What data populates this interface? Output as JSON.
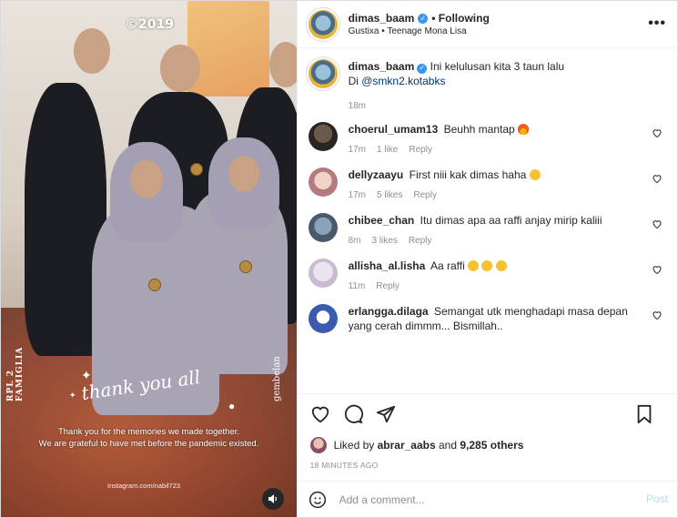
{
  "media": {
    "year_text": "©2019",
    "side_left": "RPL 2 FAMIGLIA",
    "side_right": "gembelan",
    "script_text": "thank you all",
    "message_line1": "Thank you for the memories we made together.",
    "message_line2": "We are grateful to have met before the pandemic existed.",
    "ig_handle": "Instagram.com/nabil723",
    "mute_icon": "speaker-icon"
  },
  "header": {
    "username": "dimas_baam",
    "following_label": "• Following",
    "audio": "Gustixa • Teenage Mona Lisa",
    "more_icon": "more-icon"
  },
  "caption": {
    "username": "dimas_baam",
    "text_line1": "Ini kelulusan kita 3 taun lalu",
    "text_prefix": "Di ",
    "mention": "@smkn2.kotabks",
    "time": "18m"
  },
  "comments": [
    {
      "username": "choerul_umam13",
      "text": "Beuhh mantap",
      "emoji": "fire",
      "time": "17m",
      "likes": "1 like",
      "reply": "Reply"
    },
    {
      "username": "dellyzaayu",
      "text": "First niii kak dimas haha",
      "emoji": "heart-eyes",
      "time": "17m",
      "likes": "5 likes",
      "reply": "Reply"
    },
    {
      "username": "chibee_chan",
      "text": "Itu dimas apa aa raffi anjay mirip kaliii",
      "time": "8m",
      "likes": "3 likes",
      "reply": "Reply"
    },
    {
      "username": "allisha_al.lisha",
      "text": "Aa raffi",
      "emoji": "heart-eyes x3",
      "time": "11m",
      "reply": "Reply"
    },
    {
      "username": "erlangga.dilaga",
      "text": "Semangat utk menghadapi masa depan yang cerah dimmm... Bismillah.."
    }
  ],
  "actions": {
    "like_icon": "heart-icon",
    "comment_icon": "comment-icon",
    "share_icon": "share-icon",
    "save_icon": "bookmark-icon"
  },
  "likes": {
    "prefix": "Liked by ",
    "user": "abrar_aabs",
    "middle": " and ",
    "count": "9,285 others"
  },
  "time_ago": "18 MINUTES AGO",
  "add_comment": {
    "placeholder": "Add a comment...",
    "post_label": "Post"
  },
  "colors": {
    "verified": "#3897f0",
    "mention": "#00376b",
    "post_disabled": "#b3dbff",
    "meta_gray": "#8e8e8e"
  }
}
